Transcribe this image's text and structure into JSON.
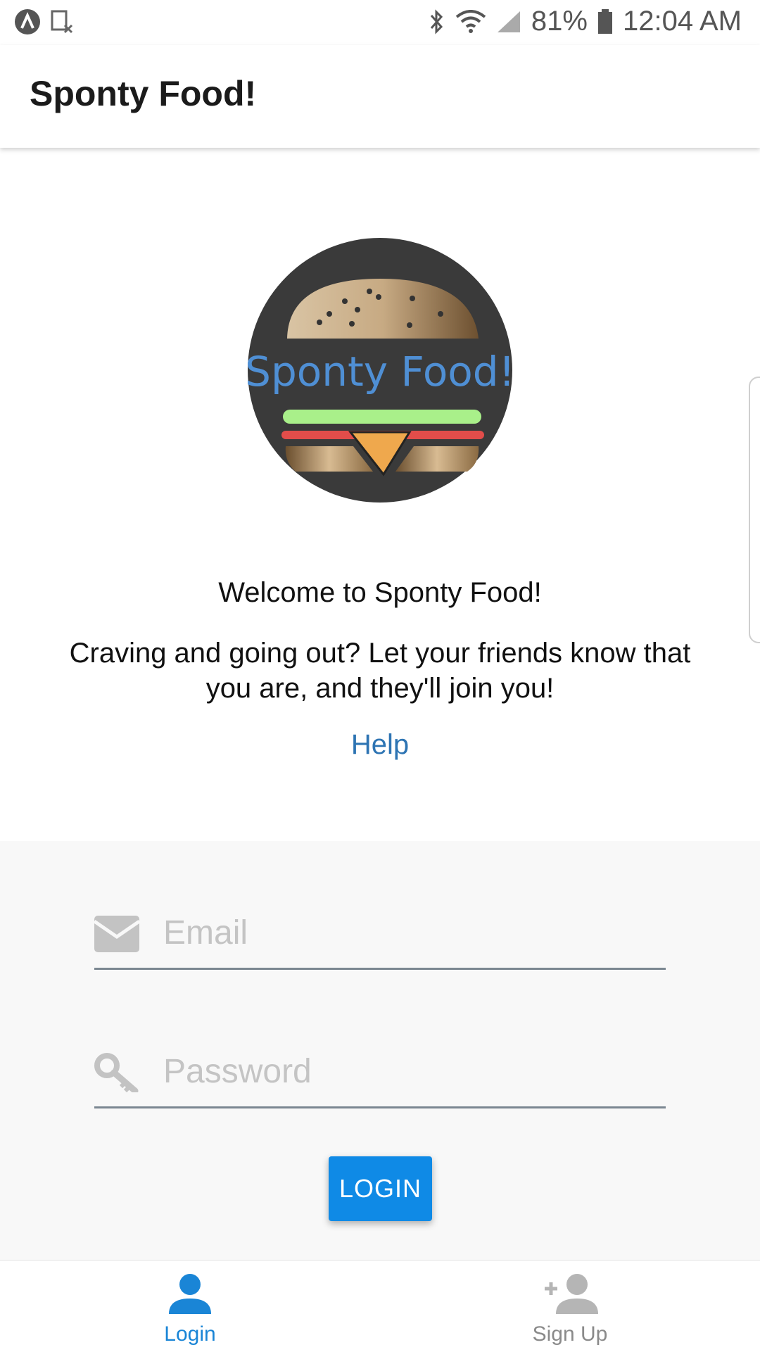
{
  "status_bar": {
    "battery": "81%",
    "time": "12:04 AM",
    "icons": [
      "app-logo-icon",
      "sim-missing-icon",
      "bluetooth-icon",
      "wifi-icon",
      "signal-icon",
      "battery-icon"
    ]
  },
  "app_bar": {
    "title": "Sponty Food!"
  },
  "hero": {
    "logo_text": "Sponty Food!",
    "welcome": "Welcome to Sponty Food!",
    "tagline": "Craving and going out? Let your friends know that you are, and they'll join you!",
    "help_link": "Help"
  },
  "form": {
    "email_placeholder": "Email",
    "email_value": "",
    "password_placeholder": "Password",
    "password_value": "",
    "login_button": "LOGIN"
  },
  "bottom_nav": {
    "items": [
      {
        "label": "Login",
        "icon": "person-icon",
        "active": true
      },
      {
        "label": "Sign Up",
        "icon": "person-add-icon",
        "active": false
      }
    ]
  },
  "colors": {
    "accent": "#0f8ae6",
    "link": "#2d74b3",
    "active_nav": "#1a85d6",
    "inactive_nav": "#8a8a8a",
    "logo_bg": "#3a3a3a"
  }
}
